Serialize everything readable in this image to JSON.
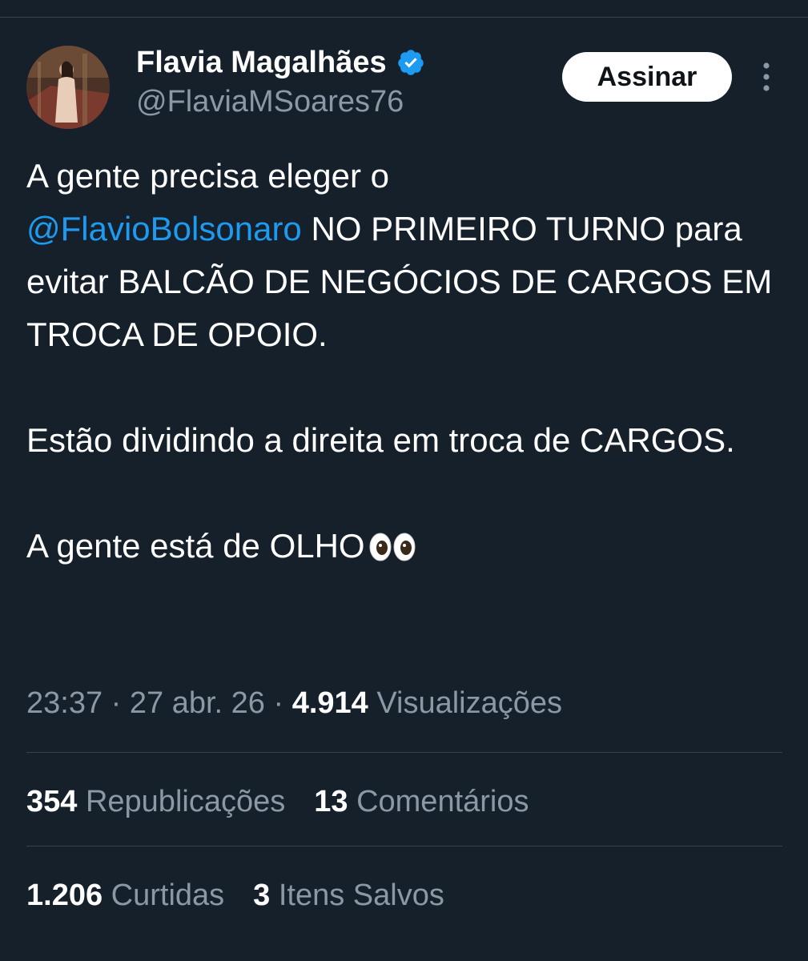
{
  "author": {
    "display_name": "Flavia Magalhães",
    "handle": "@FlaviaMSoares76",
    "verified": true,
    "verified_color": "#1d9bf0"
  },
  "actions": {
    "subscribe_label": "Assinar",
    "more_icon": "more-vertical-icon"
  },
  "tweet": {
    "line1": "A gente precisa eleger o",
    "mention": "@FlavioBolsonaro",
    "after_mention": " NO PRIMEIRO TURNO para evitar BALCÃO DE NEGÓCIOS DE CARGOS EM TROCA DE OPOIO.",
    "paragraph2": "Estão dividindo a direita em troca de CARGOS.",
    "paragraph3": "A gente está de OLHO",
    "emoji_icon": "eyes-emoji-icon"
  },
  "meta": {
    "time": "23:37",
    "separator": " · ",
    "date": "27 abr. 26",
    "views_count": "4.914",
    "views_label": " Visualizações"
  },
  "stats": {
    "reposts_count": "354",
    "reposts_label": " Republicações",
    "comments_count": "13",
    "comments_label": " Comentários",
    "likes_count": "1.206",
    "likes_label": " Curtidas",
    "saves_count": "3",
    "saves_label": " Itens Salvos"
  },
  "colors": {
    "background": "#15202b",
    "text": "#ffffff",
    "secondary": "#8b98a5",
    "link": "#1d9bf0",
    "divider": "#38444d"
  }
}
